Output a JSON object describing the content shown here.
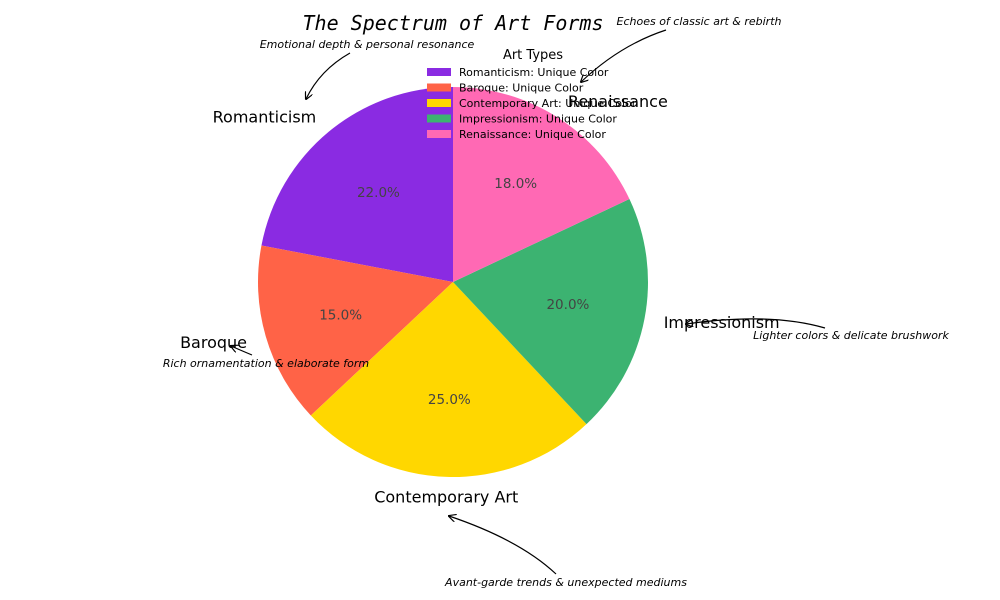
{
  "chart_data": {
    "type": "pie",
    "title": "The Spectrum of Art Forms",
    "slices": [
      {
        "label": "Romanticism",
        "value": 22.0,
        "pct_label": "22.0%",
        "color": "#8A2BE2"
      },
      {
        "label": "Baroque",
        "value": 15.0,
        "pct_label": "15.0%",
        "color": "#FF6347"
      },
      {
        "label": "Contemporary Art",
        "value": 25.0,
        "pct_label": "25.0%",
        "color": "#FFD700"
      },
      {
        "label": "Impressionism",
        "value": 20.0,
        "pct_label": "20.0%",
        "color": "#3CB371"
      },
      {
        "label": "Renaissance",
        "value": 18.0,
        "pct_label": "18.0%",
        "color": "#FF69B4"
      }
    ],
    "start_angle_deg": 90,
    "direction": "counterclockwise",
    "legend": {
      "title": "Art Types",
      "placement": "top-center",
      "entries": [
        "Romanticism: Unique Color",
        "Baroque: Unique Color",
        "Contemporary Art: Unique Color",
        "Impressionism: Unique Color",
        "Renaissance: Unique Color"
      ]
    },
    "annotations": [
      {
        "slice": "Romanticism",
        "text": "Emotional depth & personal resonance"
      },
      {
        "slice": "Renaissance",
        "text": "Echoes of classic art & rebirth"
      },
      {
        "slice": "Impressionism",
        "text": "Lighter colors & delicate brushwork"
      },
      {
        "slice": "Baroque",
        "text": "Rich ornamentation & elaborate form"
      },
      {
        "slice": "Contemporary Art",
        "text": "Avant-garde trends & unexpected mediums"
      }
    ]
  }
}
